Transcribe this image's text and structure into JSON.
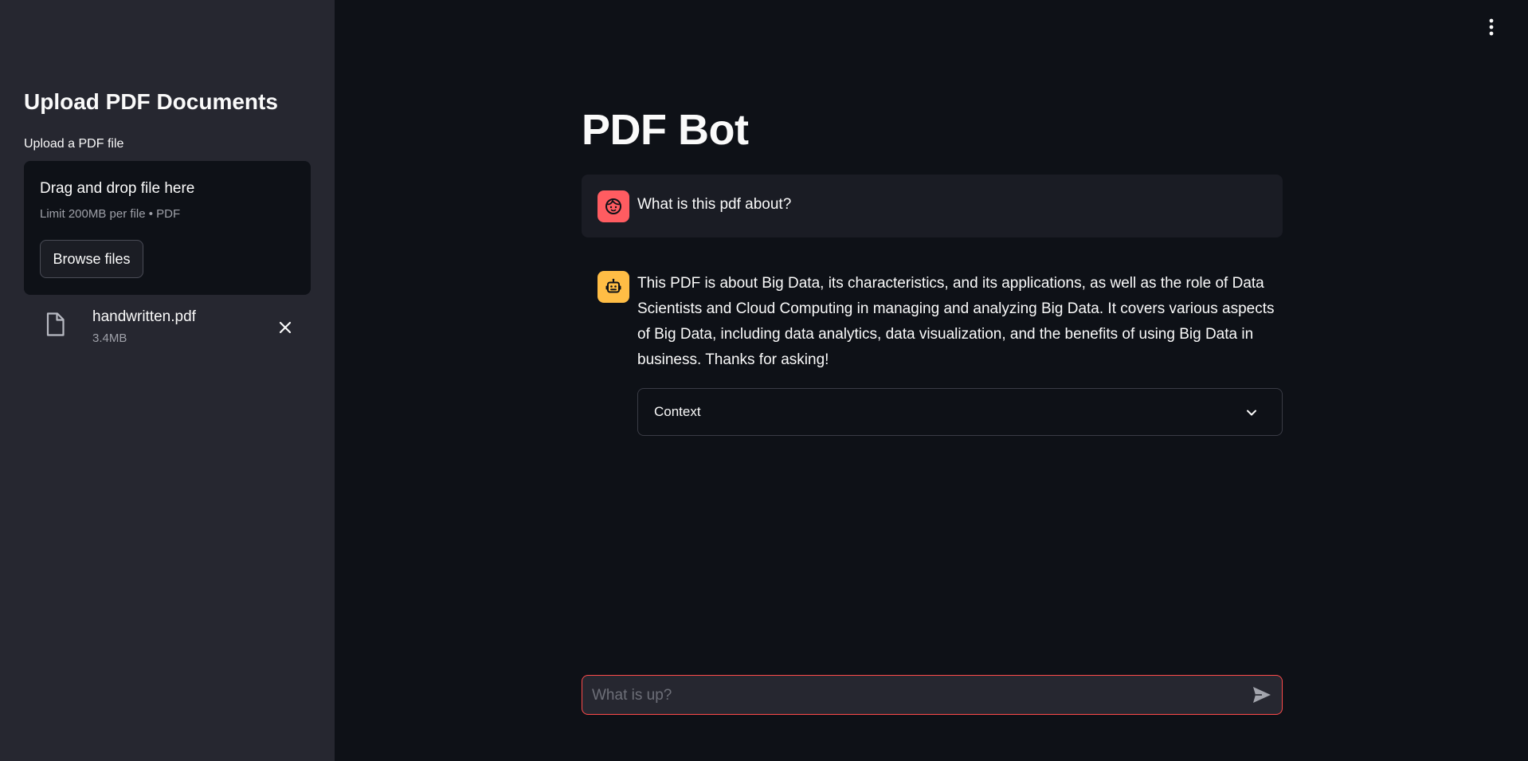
{
  "sidebar": {
    "title": "Upload PDF Documents",
    "uploader_label": "Upload a PDF file",
    "dropzone": {
      "title": "Drag and drop file here",
      "subtitle": "Limit 200MB per file • PDF",
      "browse_label": "Browse files"
    },
    "file": {
      "name": "handwritten.pdf",
      "size": "3.4MB",
      "icon": "file-icon"
    }
  },
  "main": {
    "title": "PDF Bot",
    "messages": [
      {
        "role": "user",
        "avatar_icon": "user-face-icon",
        "text": "What is this pdf about?"
      },
      {
        "role": "assistant",
        "avatar_icon": "robot-icon",
        "text": "This PDF is about Big Data, its characteristics, and its applications, as well as the role of Data Scientists and Cloud Computing in managing and analyzing Big Data. It covers various aspects of Big Data, including data analytics, data visualization, and the benefits of using Big Data in business. Thanks for asking!",
        "expander_label": "Context"
      }
    ],
    "chat_input": {
      "placeholder": "What is up?",
      "value": ""
    }
  },
  "colors": {
    "sidebar_bg": "#262730",
    "main_bg": "#0e1117",
    "user_avatar": "#ff5c61",
    "bot_avatar": "#ffbd45",
    "accent": "#ff4b4b"
  }
}
